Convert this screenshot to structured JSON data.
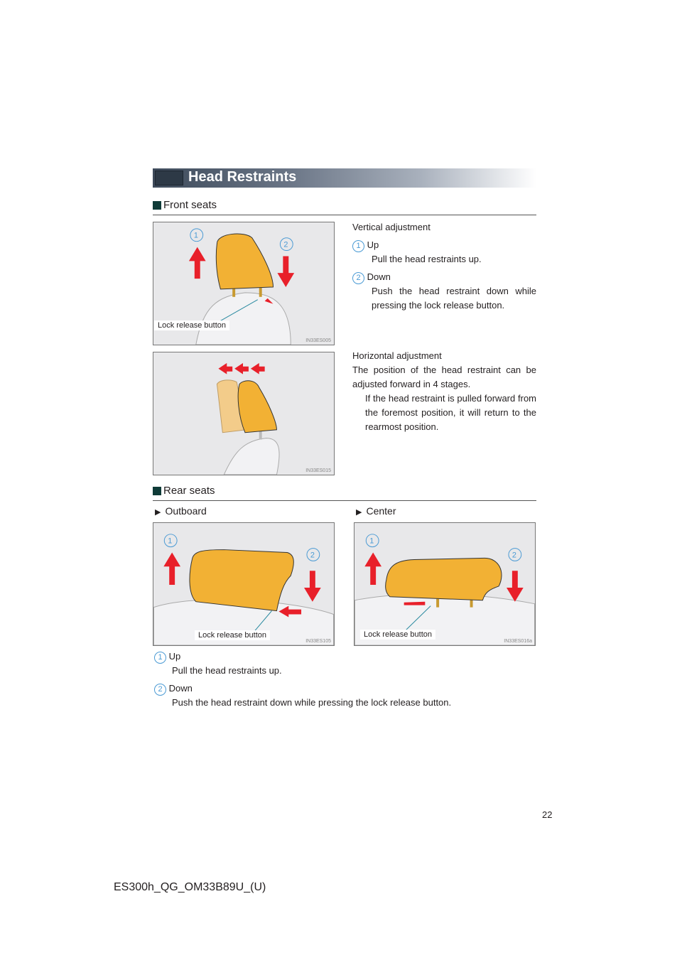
{
  "header": {
    "title": "Head Restraints"
  },
  "front": {
    "section": "Front seats",
    "fig1": {
      "label": "Lock release button",
      "code": "IN33ES005"
    },
    "fig2": {
      "code": "IN33ES015"
    },
    "vertical": {
      "title": "Vertical adjustment",
      "items": [
        {
          "num": "1",
          "label": "Up",
          "desc": "Pull the head restraints up."
        },
        {
          "num": "2",
          "label": "Down",
          "desc": "Push the head restraint down while pressing the lock release button."
        }
      ]
    },
    "horizontal": {
      "title": "Horizontal adjustment",
      "desc": "The position of the head restraint can be adjusted forward in 4 stages.",
      "note": "If the head restraint is pulled forward from the foremost position, it will return to the rearmost position."
    }
  },
  "rear": {
    "section": "Rear seats",
    "outboard": {
      "title": "Outboard",
      "label": "Lock release button",
      "code": "IN33ES105"
    },
    "center": {
      "title": "Center",
      "label": "Lock release button",
      "code": "IN33ES016a"
    },
    "items": [
      {
        "num": "1",
        "label": "Up",
        "desc": "Pull the head restraints up."
      },
      {
        "num": "2",
        "label": "Down",
        "desc": "Push the head restraint down while pressing the lock release button."
      }
    ]
  },
  "footer": {
    "page": "22",
    "doc": "ES300h_QG_OM33B89U_(U)"
  },
  "colors": {
    "accent": "#4a9ad4",
    "arrow": "#e8202a",
    "restraint": "#f2b134"
  }
}
